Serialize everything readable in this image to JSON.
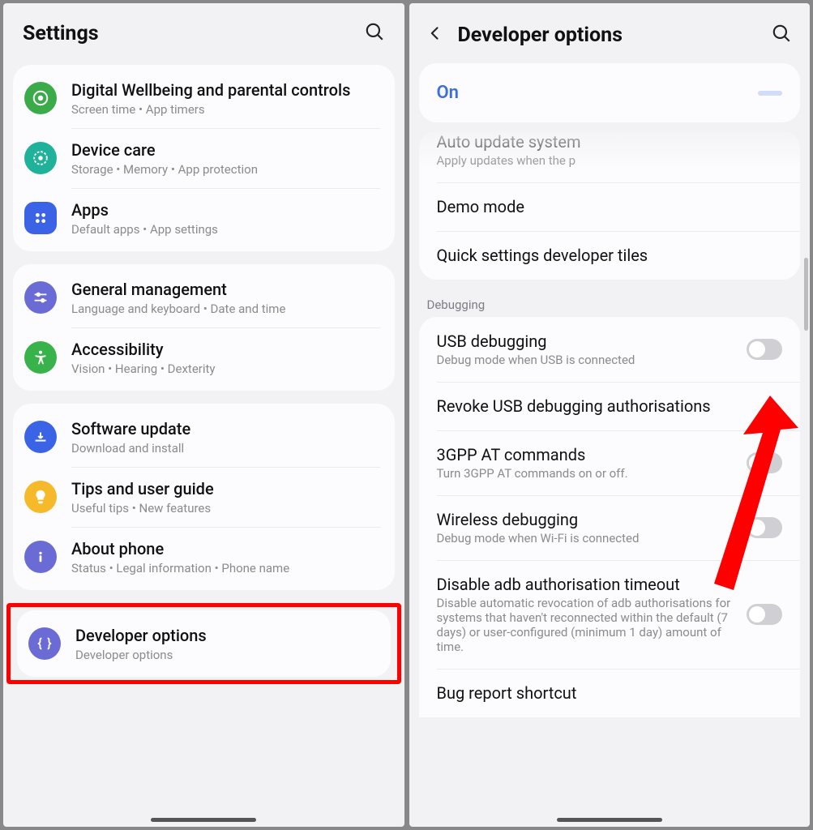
{
  "left": {
    "header": {
      "title": "Settings"
    },
    "cards": [
      {
        "rows": [
          {
            "icon": "wellbeing-icon",
            "color": "#3bab4a",
            "title": "Digital Wellbeing and parental controls",
            "sub": "Screen time  •  App timers"
          },
          {
            "icon": "shield-icon",
            "color": "#1fb19a",
            "title": "Device care",
            "sub": "Storage  •  Memory  •  App protection"
          },
          {
            "icon": "apps-icon",
            "color": "#3b63e6",
            "title": "Apps",
            "sub": "Default apps  •  App settings"
          }
        ]
      },
      {
        "rows": [
          {
            "icon": "sliders-icon",
            "color": "#6b6bd6",
            "title": "General management",
            "sub": "Language and keyboard  •  Date and time"
          },
          {
            "icon": "a11y-icon",
            "color": "#38b24a",
            "title": "Accessibility",
            "sub": "Vision  •  Hearing  •  Dexterity"
          }
        ]
      },
      {
        "rows": [
          {
            "icon": "update-icon",
            "color": "#3b63e6",
            "title": "Software update",
            "sub": "Download and install"
          },
          {
            "icon": "bulb-icon",
            "color": "#f5b92a",
            "title": "Tips and user guide",
            "sub": "Useful tips  •  New features"
          },
          {
            "icon": "info-icon",
            "color": "#6b6bd6",
            "title": "About phone",
            "sub": "Status  •  Legal information  •  Phone name"
          }
        ]
      }
    ],
    "highlight": {
      "icon": "braces-icon",
      "color": "#6b6bd6",
      "title": "Developer options",
      "sub": "Developer options"
    }
  },
  "right": {
    "header": {
      "title": "Developer options"
    },
    "on_label": "On",
    "cutoff": {
      "title": "Auto update system",
      "sub": "Apply updates when the p"
    },
    "simple": [
      {
        "title": "Demo mode"
      },
      {
        "title": "Quick settings developer tiles"
      }
    ],
    "section": "Debugging",
    "debug_items": [
      {
        "title": "USB debugging",
        "sub": "Debug mode when USB is connected",
        "toggle": true
      },
      {
        "title": "Revoke USB debugging authorisations",
        "sub": "",
        "toggle": false
      },
      {
        "title": "3GPP AT commands",
        "sub": "Turn 3GPP AT commands on or off.",
        "toggle": true
      },
      {
        "title": "Wireless debugging",
        "sub": "Debug mode when Wi-Fi is connected",
        "toggle": true
      },
      {
        "title": "Disable adb authorisation timeout",
        "sub": "Disable automatic revocation of adb authorisations for systems that haven't reconnected within the default (7 days) or user-configured (minimum 1 day) amount of time.",
        "toggle": true
      },
      {
        "title": "Bug report shortcut",
        "sub": "",
        "toggle": false
      }
    ]
  }
}
